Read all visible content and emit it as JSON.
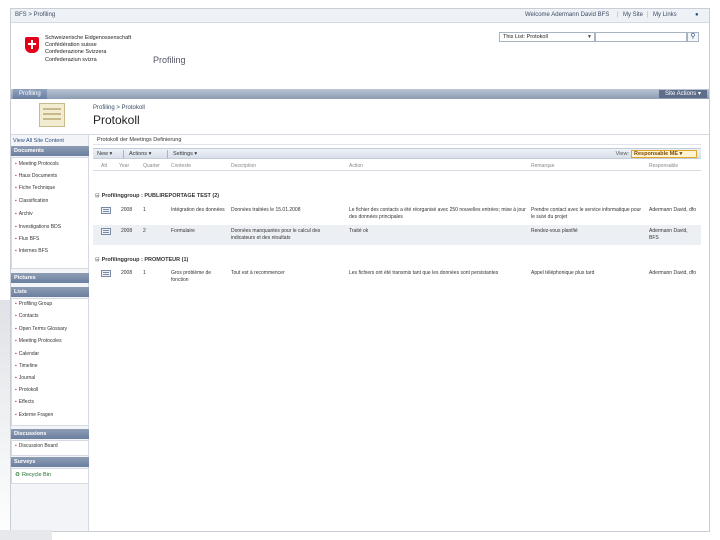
{
  "topbar": {
    "left_text": "BFS > Profiling",
    "welcome": "Welcome Adermann David BFS",
    "mysite": "My Site",
    "mylinks": "My Links",
    "help_icon": "help-icon"
  },
  "header": {
    "org_lines": [
      "Schweizerische Eidgenossenschaft",
      "Confédération suisse",
      "Confederazione Svizzera",
      "Confederaziun svizra"
    ],
    "site_name": "Profiling",
    "search_scope": "This List: Protokoll",
    "search_value": ""
  },
  "tabs": {
    "active": "Profiling",
    "site_actions": "Site Actions"
  },
  "page": {
    "breadcrumb": "Profiling > Protokoll",
    "title": "Protokoll"
  },
  "leftnav": {
    "view_all": "View All Site Content",
    "documents_header": "Documents",
    "documents": [
      "Meeting Protocols",
      "Haus Documents",
      "Fiche Technique",
      "Classification",
      "Archiv",
      "Investigations BDS",
      "Flux BFS",
      "Internes BFS"
    ],
    "pictures_header": "Pictures",
    "lists_header": "Lists",
    "lists": [
      "Profiling Group",
      "Contacts",
      "Open Terms Glossary",
      "Meeting Protocoles",
      "Calendar",
      "Timeline",
      "Journal",
      "Protokoll",
      "Effects",
      "Externe Fragen"
    ],
    "discussions_header": "Discussions",
    "discussions": [
      "Discussion Board"
    ],
    "surveys_header": "Surveys",
    "recycle_bin": "Recycle Bin"
  },
  "main": {
    "description": "Protokoll der Meetings Definierung",
    "toolbar": {
      "new": "New",
      "actions": "Actions",
      "settings": "Settings",
      "view_label": "View:",
      "view_value": "Responsable ME"
    },
    "columns": [
      "Att",
      "Year",
      "Quarter",
      "Contexte",
      "Description",
      "Action",
      "Remarque",
      "Responsable"
    ],
    "groups": [
      {
        "label": "Profilinggroup : PUBLIREPORTAGE TEST (2)",
        "rows": [
          {
            "year": "2008",
            "q": "1",
            "context": "Intégration des données",
            "desc": "Données traitées le 15.01.2008",
            "action": "Le fichier des contacts a été réorganisé avec 250 nouvelles entrées; mise à jour des données principales",
            "remark": "Prendre contact avec le service informatique pour le suivi du projet",
            "resp": "Adermann David, dfo"
          },
          {
            "year": "2008",
            "q": "2",
            "context": "Formulaire",
            "desc": "Données manquantes pour le calcul des indicateurs et des résultats",
            "action": "Traité ok",
            "remark": "Rendez-vous planifié",
            "resp": "Adermann David, BFS"
          }
        ]
      },
      {
        "label": "Profilinggroup : PROMOTEUR (1)",
        "rows": [
          {
            "year": "2008",
            "q": "1",
            "context": "Gros problème de fonction",
            "desc": "Tout est à recommencer",
            "action": "Les fichiers ont été transmis tant que les données sont persistantes",
            "remark": "Appel téléphonique plus tard",
            "resp": "Adermann David, dfo"
          }
        ]
      }
    ]
  }
}
